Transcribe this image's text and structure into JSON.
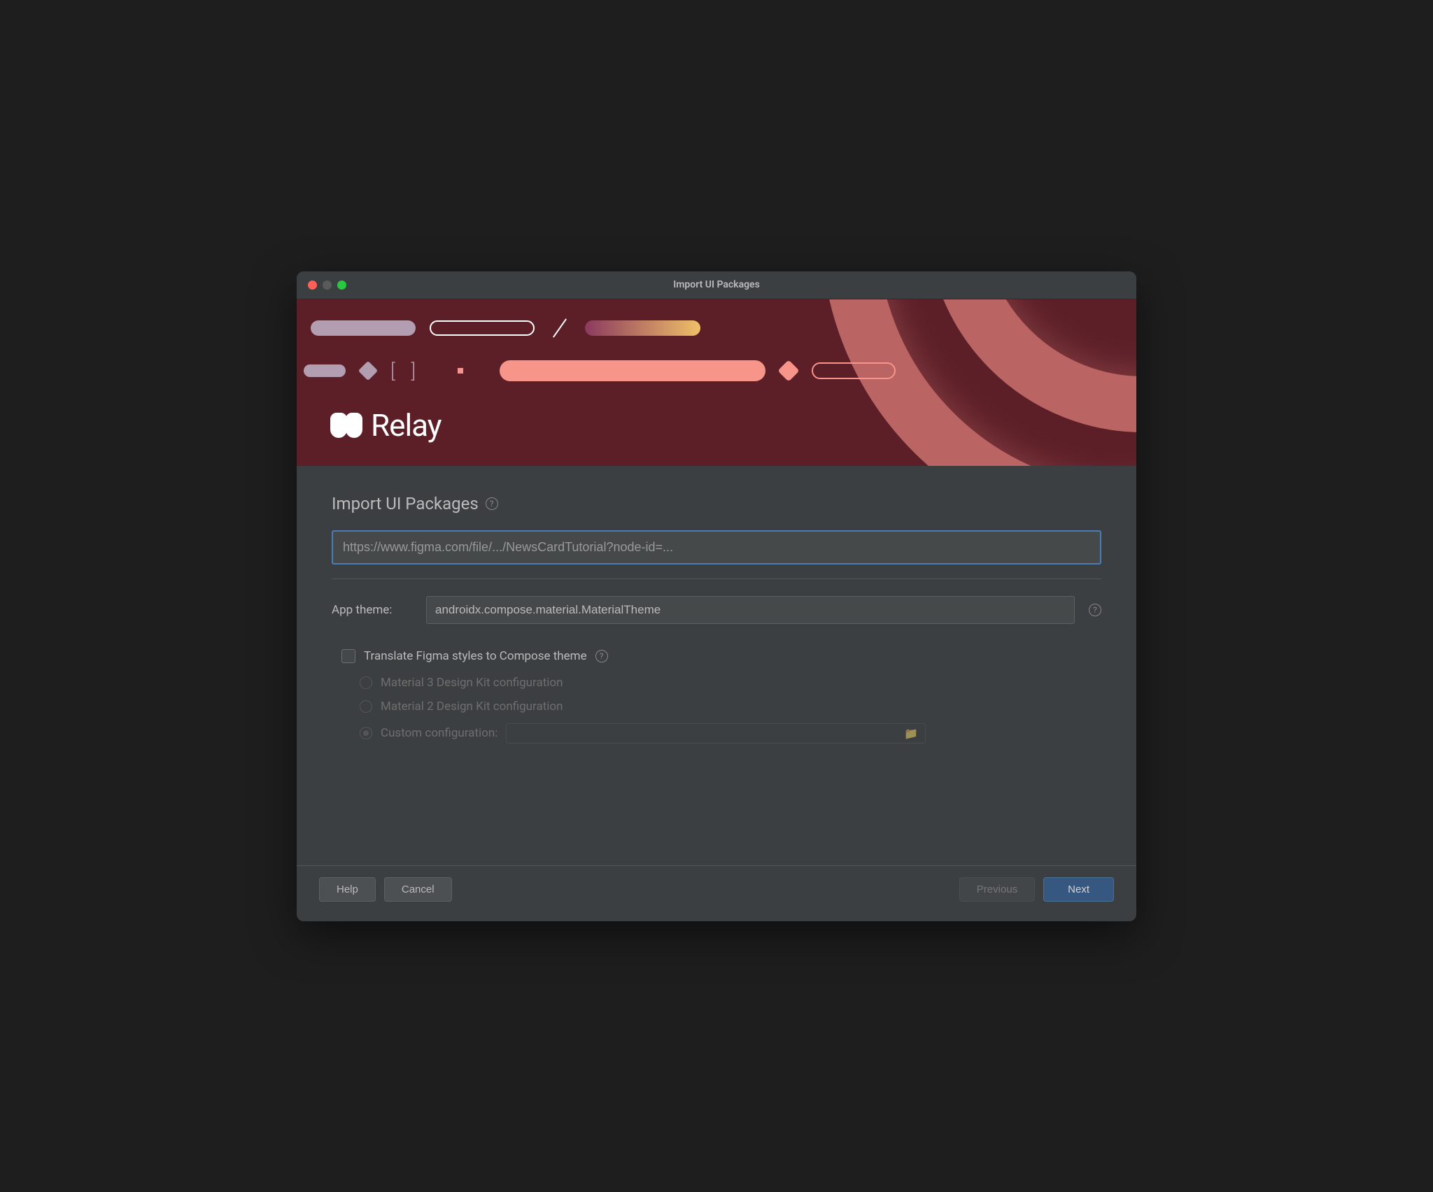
{
  "window": {
    "title": "Import UI Packages"
  },
  "banner": {
    "logo_text": "Relay"
  },
  "main": {
    "section_title": "Import UI Packages",
    "url_value": "https://www.figma.com/file/.../NewsCardTutorial?node-id=...",
    "app_theme_label": "App theme:",
    "app_theme_value": "androidx.compose.material.MaterialTheme",
    "translate_checkbox_label": "Translate Figma styles to Compose theme",
    "radio_options": {
      "material3": "Material 3 Design Kit configuration",
      "material2": "Material 2 Design Kit configuration",
      "custom": "Custom configuration:"
    }
  },
  "footer": {
    "help": "Help",
    "cancel": "Cancel",
    "previous": "Previous",
    "next": "Next"
  }
}
